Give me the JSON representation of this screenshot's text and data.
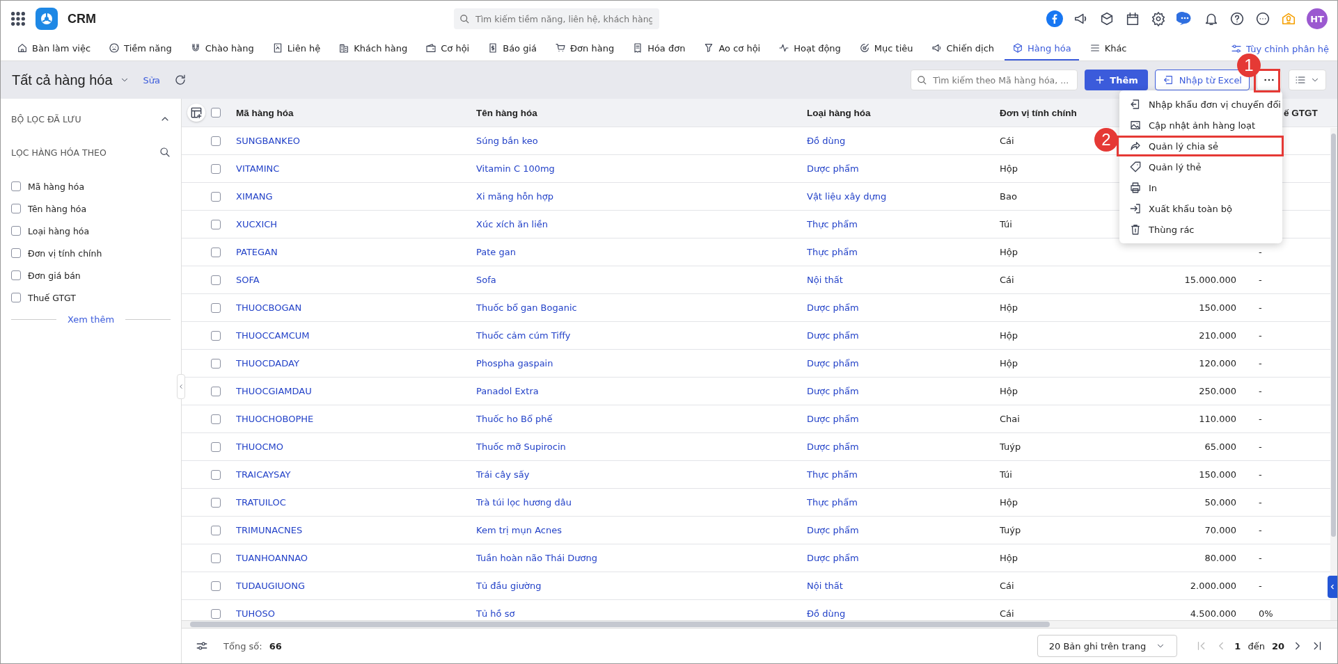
{
  "app": {
    "name": "CRM",
    "search_placeholder": "Tìm kiếm tiềm năng, liên hệ, khách hàng",
    "avatar": "HT"
  },
  "nav": [
    {
      "label": "Bàn làm việc",
      "selected": false
    },
    {
      "label": "Tiềm năng",
      "selected": false
    },
    {
      "label": "Chào hàng",
      "selected": false
    },
    {
      "label": "Liên hệ",
      "selected": false
    },
    {
      "label": "Khách hàng",
      "selected": false
    },
    {
      "label": "Cơ hội",
      "selected": false
    },
    {
      "label": "Báo giá",
      "selected": false
    },
    {
      "label": "Đơn hàng",
      "selected": false
    },
    {
      "label": "Hóa đơn",
      "selected": false
    },
    {
      "label": "Ao cơ hội",
      "selected": false
    },
    {
      "label": "Hoạt động",
      "selected": false
    },
    {
      "label": "Mục tiêu",
      "selected": false
    },
    {
      "label": "Chiến dịch",
      "selected": false
    },
    {
      "label": "Hàng hóa",
      "selected": true
    },
    {
      "label": "Khác",
      "selected": false
    }
  ],
  "customize": "Tùy chỉnh phân hệ",
  "toolbar": {
    "title": "Tất cả hàng hóa",
    "edit": "Sửa",
    "search_placeholder": "Tìm kiếm theo Mã hàng hóa, ...",
    "add": "Thêm",
    "import": "Nhập từ Excel"
  },
  "sidebar": {
    "saved_title": "BỘ LỌC ĐÃ LƯU",
    "filter_title": "LỌC HÀNG HÓA THEO",
    "filters": [
      {
        "label": "Mã hàng hóa",
        "checked": false
      },
      {
        "label": "Tên hàng hóa",
        "checked": false
      },
      {
        "label": "Loại hàng hóa",
        "checked": false
      },
      {
        "label": "Đơn vị tính chính",
        "checked": false
      },
      {
        "label": "Đơn giá bán",
        "checked": false
      },
      {
        "label": "Thuế GTGT",
        "checked": false
      }
    ],
    "more": "Xem thêm"
  },
  "table": {
    "select_all_checked": false,
    "columns": [
      "Mã hàng hóa",
      "Tên hàng hóa",
      "Loại hàng hóa",
      "Đơn vị tính chính",
      "",
      "ế GTGT"
    ],
    "rows": [
      {
        "checked": false,
        "code": "SUNGBANKEO",
        "name": "Súng bắn keo",
        "type": "Đồ dùng",
        "unit": "Cái"
      },
      {
        "checked": false,
        "code": "VITAMINC",
        "name": "Vitamin C 100mg",
        "type": "Dược phẩm",
        "unit": "Hộp"
      },
      {
        "checked": false,
        "code": "XIMANG",
        "name": "Xi măng hỗn hợp",
        "type": "Vật liệu xây dựng",
        "unit": "Bao"
      },
      {
        "checked": false,
        "code": "XUCXICH",
        "name": "Xúc xích ăn liền",
        "type": "Thực phẩm",
        "unit": "Túi"
      },
      {
        "checked": false,
        "code": "PATEGAN",
        "name": "Pate gan",
        "type": "Thực phẩm",
        "unit": "Hộp",
        "tax": "-"
      },
      {
        "checked": false,
        "code": "SOFA",
        "name": "Sofa",
        "type": "Nội thất",
        "unit": "Cái",
        "price": "15.000.000",
        "tax": "-"
      },
      {
        "checked": false,
        "code": "THUOCBOGAN",
        "name": "Thuốc bổ gan Boganic",
        "type": "Dược phẩm",
        "unit": "Hộp",
        "price": "150.000",
        "tax": "-"
      },
      {
        "checked": false,
        "code": "THUOCCAMCUM",
        "name": "Thuốc cảm cúm Tiffy",
        "type": "Dược phẩm",
        "unit": "Hộp",
        "price": "210.000",
        "tax": "-"
      },
      {
        "checked": false,
        "code": "THUOCDADAY",
        "name": "Phospha gaspain",
        "type": "Dược phẩm",
        "unit": "Hộp",
        "price": "120.000",
        "tax": "-"
      },
      {
        "checked": false,
        "code": "THUOCGIAMDAU",
        "name": "Panadol Extra",
        "type": "Dược phẩm",
        "unit": "Hộp",
        "price": "250.000",
        "tax": "-"
      },
      {
        "checked": false,
        "code": "THUOCHOBOPHE",
        "name": "Thuốc ho Bổ phế",
        "type": "Dược phẩm",
        "unit": "Chai",
        "price": "110.000",
        "tax": "-"
      },
      {
        "checked": false,
        "code": "THUOCMO",
        "name": "Thuốc mỡ Supirocin",
        "type": "Dược phẩm",
        "unit": "Tuýp",
        "price": "65.000",
        "tax": "-"
      },
      {
        "checked": false,
        "code": "TRAICAYSAY",
        "name": "Trái cây sấy",
        "type": "Thực phẩm",
        "unit": "Túi",
        "price": "150.000",
        "tax": "-"
      },
      {
        "checked": false,
        "code": "TRATUILOC",
        "name": "Trà túi lọc hương dâu",
        "type": "Thực phẩm",
        "unit": "Hộp",
        "price": "50.000",
        "tax": "-"
      },
      {
        "checked": false,
        "code": "TRIMUNACNES",
        "name": "Kem trị mụn Acnes",
        "type": "Dược phẩm",
        "unit": "Tuýp",
        "price": "70.000",
        "tax": "-"
      },
      {
        "checked": false,
        "code": "TUANHOANNAO",
        "name": "Tuần hoàn não Thái Dương",
        "type": "Dược phẩm",
        "unit": "Hộp",
        "price": "80.000",
        "tax": "-"
      },
      {
        "checked": false,
        "code": "TUDAUGIUONG",
        "name": "Tủ đầu giường",
        "type": "Nội thất",
        "unit": "Cái",
        "price": "2.000.000",
        "tax": "-"
      },
      {
        "checked": false,
        "code": "TUHOSO",
        "name": "Tủ hồ sơ",
        "type": "Đồ dùng",
        "unit": "Cái",
        "price": "4.500.000",
        "tax": "0%"
      }
    ]
  },
  "footer": {
    "total_label": "Tổng số:",
    "total": "66",
    "page_size": "20 Bản ghi trên trang",
    "page": "1",
    "to": "đến",
    "page_end": "20"
  },
  "menu": [
    {
      "label": "Nhập khẩu đơn vị chuyển đổi",
      "highlighted": false
    },
    {
      "label": "Cập nhật ảnh hàng loạt",
      "highlighted": false
    },
    {
      "label": "Quản lý chia sẻ",
      "highlighted": true
    },
    {
      "label": "Quản lý thẻ",
      "highlighted": false
    },
    {
      "label": "In",
      "highlighted": false
    },
    {
      "label": "Xuất khẩu toàn bộ",
      "highlighted": false
    },
    {
      "label": "Thùng rác",
      "highlighted": false
    }
  ],
  "callouts": [
    "1",
    "2"
  ]
}
